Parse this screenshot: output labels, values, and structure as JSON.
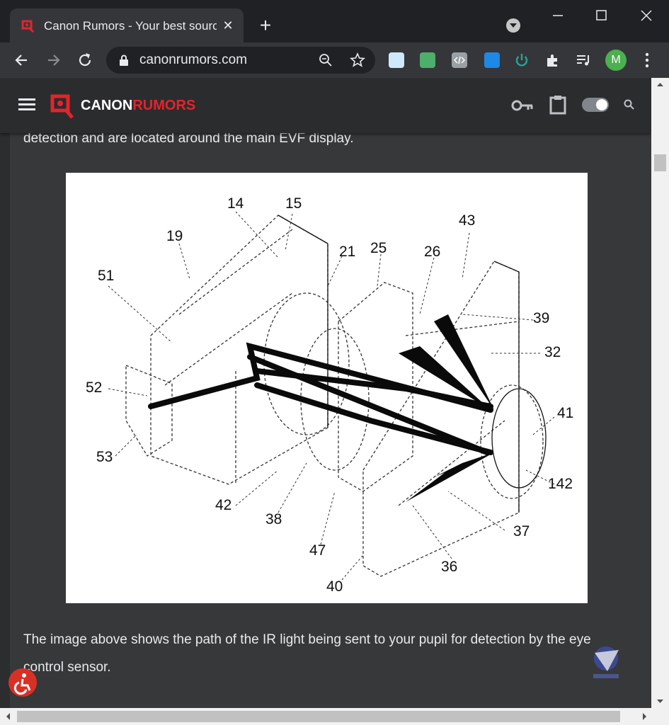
{
  "browser": {
    "tab_title": "Canon Rumors - Your best source",
    "tab_close": "✕",
    "new_tab": "+",
    "url": "canonrumors.com",
    "window_minimize": "—",
    "window_maximize": "☐",
    "window_close": "✕",
    "profile_initial": "M"
  },
  "site": {
    "logo_canon": "CANON",
    "logo_rumors": "RUMORS"
  },
  "article": {
    "para_top": "detection and are located around the main EVF display.",
    "para_bottom_line1": "The image above shows the path of the IR light being sent to your pupil for detection by the eye",
    "para_bottom_line2": "control sensor."
  },
  "figure": {
    "labels": [
      "14",
      "15",
      "19",
      "21",
      "25",
      "26",
      "43",
      "51",
      "39",
      "32",
      "52",
      "41",
      "53",
      "142",
      "42",
      "38",
      "37",
      "47",
      "36",
      "40"
    ]
  },
  "colors": {
    "brand_red": "#e3242b",
    "page_bg": "#37383a",
    "text": "#e8eaed"
  }
}
